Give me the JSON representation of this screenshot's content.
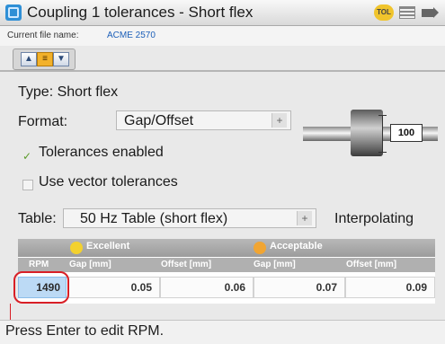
{
  "window": {
    "title": "Coupling 1 tolerances - Short flex",
    "badge": "TOL",
    "file_label": "Current file name:",
    "file_name": "ACME 2570"
  },
  "toolbar": {
    "buttons": [
      "▲",
      "≡",
      "▼"
    ]
  },
  "form": {
    "type_label": "Type: Short flex",
    "format_label": "Format:",
    "format_value": "Gap/Offset",
    "tolerances_enabled_label": "Tolerances enabled",
    "vector_tolerances_label": "Use vector tolerances",
    "table_label": "Table:",
    "table_value": "50 Hz Table (short flex)",
    "interpolating_label": "Interpolating",
    "coupling_dimension": "100"
  },
  "table": {
    "groups": {
      "excellent": "Excellent",
      "acceptable": "Acceptable"
    },
    "headers": [
      "RPM",
      "Gap [mm]",
      "Offset [mm]",
      "Gap [mm]",
      "Offset [mm]"
    ],
    "row": {
      "rpm": "1490",
      "excellent_gap": "0.05",
      "excellent_offset": "0.06",
      "acceptable_gap": "0.07",
      "acceptable_offset": "0.09"
    }
  },
  "status": {
    "text": "Press Enter to edit RPM."
  }
}
